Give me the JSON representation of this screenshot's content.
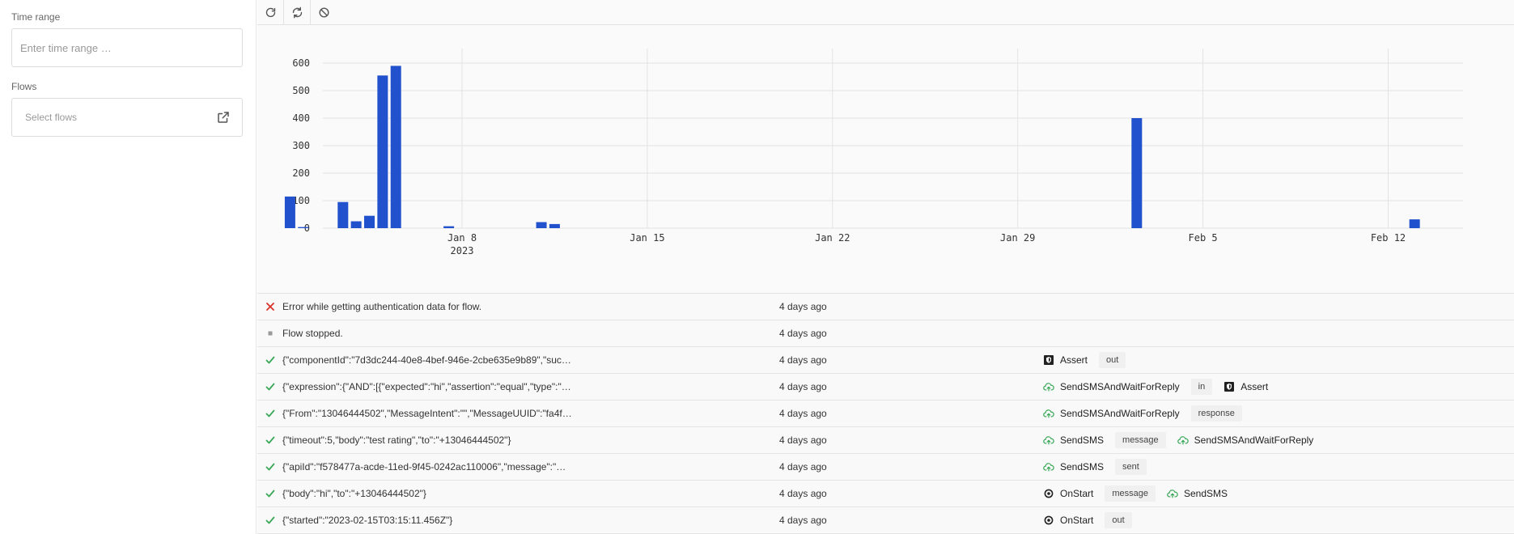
{
  "sidebar": {
    "time_range_label": "Time range",
    "time_range_placeholder": "Enter time range …",
    "flows_label": "Flows",
    "flows_placeholder": "Select flows"
  },
  "toolbar": {
    "buttons": [
      "refresh-icon",
      "sync-icon",
      "ban-icon"
    ]
  },
  "chart_data": {
    "type": "bar",
    "x_ticks": [
      "Jan 8",
      "Jan 15",
      "Jan 22",
      "Jan 29",
      "Feb 5",
      "Feb 12"
    ],
    "x_tick_sub": "2023",
    "y_ticks": [
      0,
      100,
      200,
      300,
      400,
      500,
      600
    ],
    "ylim": [
      0,
      640
    ],
    "bars": [
      {
        "x": 0.3,
        "y": 115
      },
      {
        "x": 0.8,
        "y": 4
      },
      {
        "x": 2.3,
        "y": 95
      },
      {
        "x": 2.8,
        "y": 25
      },
      {
        "x": 3.3,
        "y": 45
      },
      {
        "x": 3.8,
        "y": 555
      },
      {
        "x": 4.3,
        "y": 590
      },
      {
        "x": 6.3,
        "y": 7
      },
      {
        "x": 9.8,
        "y": 22
      },
      {
        "x": 10.3,
        "y": 15
      },
      {
        "x": 32.3,
        "y": 400
      },
      {
        "x": 42.8,
        "y": 32
      }
    ],
    "colors": {
      "bar": "#2151cc",
      "grid": "#e3e3e3"
    }
  },
  "logs": [
    {
      "status": "error",
      "message": "Error while getting authentication data for flow.",
      "time": "4 days ago",
      "comps": []
    },
    {
      "status": "stopped",
      "message": "Flow stopped.",
      "time": "4 days ago",
      "comps": []
    },
    {
      "status": "ok",
      "message": "{\"componentId\":\"7d3dc244-40e8-4bef-946e-2cbe635e9b89\",\"suc…",
      "time": "4 days ago",
      "comps": [
        {
          "kind": "comp",
          "icon": "shield-icon",
          "label": "Assert"
        },
        {
          "kind": "port",
          "label": "out"
        }
      ]
    },
    {
      "status": "ok",
      "message": "{\"expression\":{\"AND\":[{\"expected\":\"hi\",\"assertion\":\"equal\",\"type\":\"…",
      "time": "4 days ago",
      "comps": [
        {
          "kind": "comp",
          "icon": "cloud-upload-icon",
          "label": "SendSMSAndWaitForReply"
        },
        {
          "kind": "port",
          "label": "in"
        },
        {
          "kind": "comp",
          "icon": "shield-icon",
          "label": "Assert"
        }
      ]
    },
    {
      "status": "ok",
      "message": "{\"From\":\"13046444502\",\"MessageIntent\":\"\",\"MessageUUID\":\"fa4f…",
      "time": "4 days ago",
      "comps": [
        {
          "kind": "comp",
          "icon": "cloud-upload-icon",
          "label": "SendSMSAndWaitForReply"
        },
        {
          "kind": "port",
          "label": "response"
        }
      ]
    },
    {
      "status": "ok",
      "message": "{\"timeout\":5,\"body\":\"test rating\",\"to\":\"+13046444502\"}",
      "time": "4 days ago",
      "comps": [
        {
          "kind": "comp",
          "icon": "cloud-upload-icon",
          "label": "SendSMS"
        },
        {
          "kind": "port",
          "label": "message"
        },
        {
          "kind": "comp",
          "icon": "cloud-upload-icon",
          "label": "SendSMSAndWaitForReply"
        }
      ]
    },
    {
      "status": "ok",
      "message": "{\"apiId\":\"f578477a-acde-11ed-9f45-0242ac110006\",\"message\":\"…",
      "time": "4 days ago",
      "comps": [
        {
          "kind": "comp",
          "icon": "cloud-upload-icon",
          "label": "SendSMS"
        },
        {
          "kind": "port",
          "label": "sent"
        }
      ]
    },
    {
      "status": "ok",
      "message": "{\"body\":\"hi\",\"to\":\"+13046444502\"}",
      "time": "4 days ago",
      "comps": [
        {
          "kind": "comp",
          "icon": "target-icon",
          "label": "OnStart"
        },
        {
          "kind": "port",
          "label": "message"
        },
        {
          "kind": "comp",
          "icon": "cloud-upload-icon",
          "label": "SendSMS"
        }
      ]
    },
    {
      "status": "ok",
      "message": "{\"started\":\"2023-02-15T03:15:11.456Z\"}",
      "time": "4 days ago",
      "comps": [
        {
          "kind": "comp",
          "icon": "target-icon",
          "label": "OnStart"
        },
        {
          "kind": "port",
          "label": "out"
        }
      ]
    }
  ],
  "colors": {
    "ok": "#3aa757",
    "error": "#d9342b",
    "stopped": "#999999",
    "cloud": "#3aa757"
  }
}
